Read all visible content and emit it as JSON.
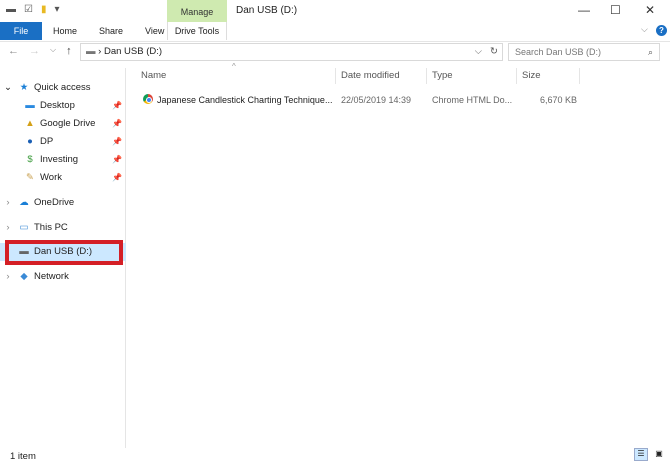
{
  "window": {
    "title": "Dan USB (D:)",
    "context_tab": "Manage",
    "context_subtab": "Drive Tools"
  },
  "ribbon": {
    "tabs": [
      "File",
      "Home",
      "Share",
      "View"
    ]
  },
  "address": {
    "path": "Dan USB (D:)",
    "search_placeholder": "Search Dan USB (D:)"
  },
  "nav": {
    "quick_access": "Quick access",
    "pinned": [
      "Desktop",
      "Google Drive",
      "DP",
      "Investing",
      "Work"
    ],
    "onedrive": "OneDrive",
    "this_pc": "This PC",
    "usb": "Dan USB (D:)",
    "network": "Network"
  },
  "columns": [
    "Name",
    "Date modified",
    "Type",
    "Size"
  ],
  "files": [
    {
      "name": "Japanese Candlestick Charting Technique...",
      "date": "22/05/2019 14:39",
      "type": "Chrome HTML Do...",
      "size": "6,670 KB"
    }
  ],
  "status": {
    "count": "1 item"
  },
  "colors": {
    "accent": "#1a6fc4",
    "selection": "#cce8ff",
    "highlight": "#d41f26"
  }
}
